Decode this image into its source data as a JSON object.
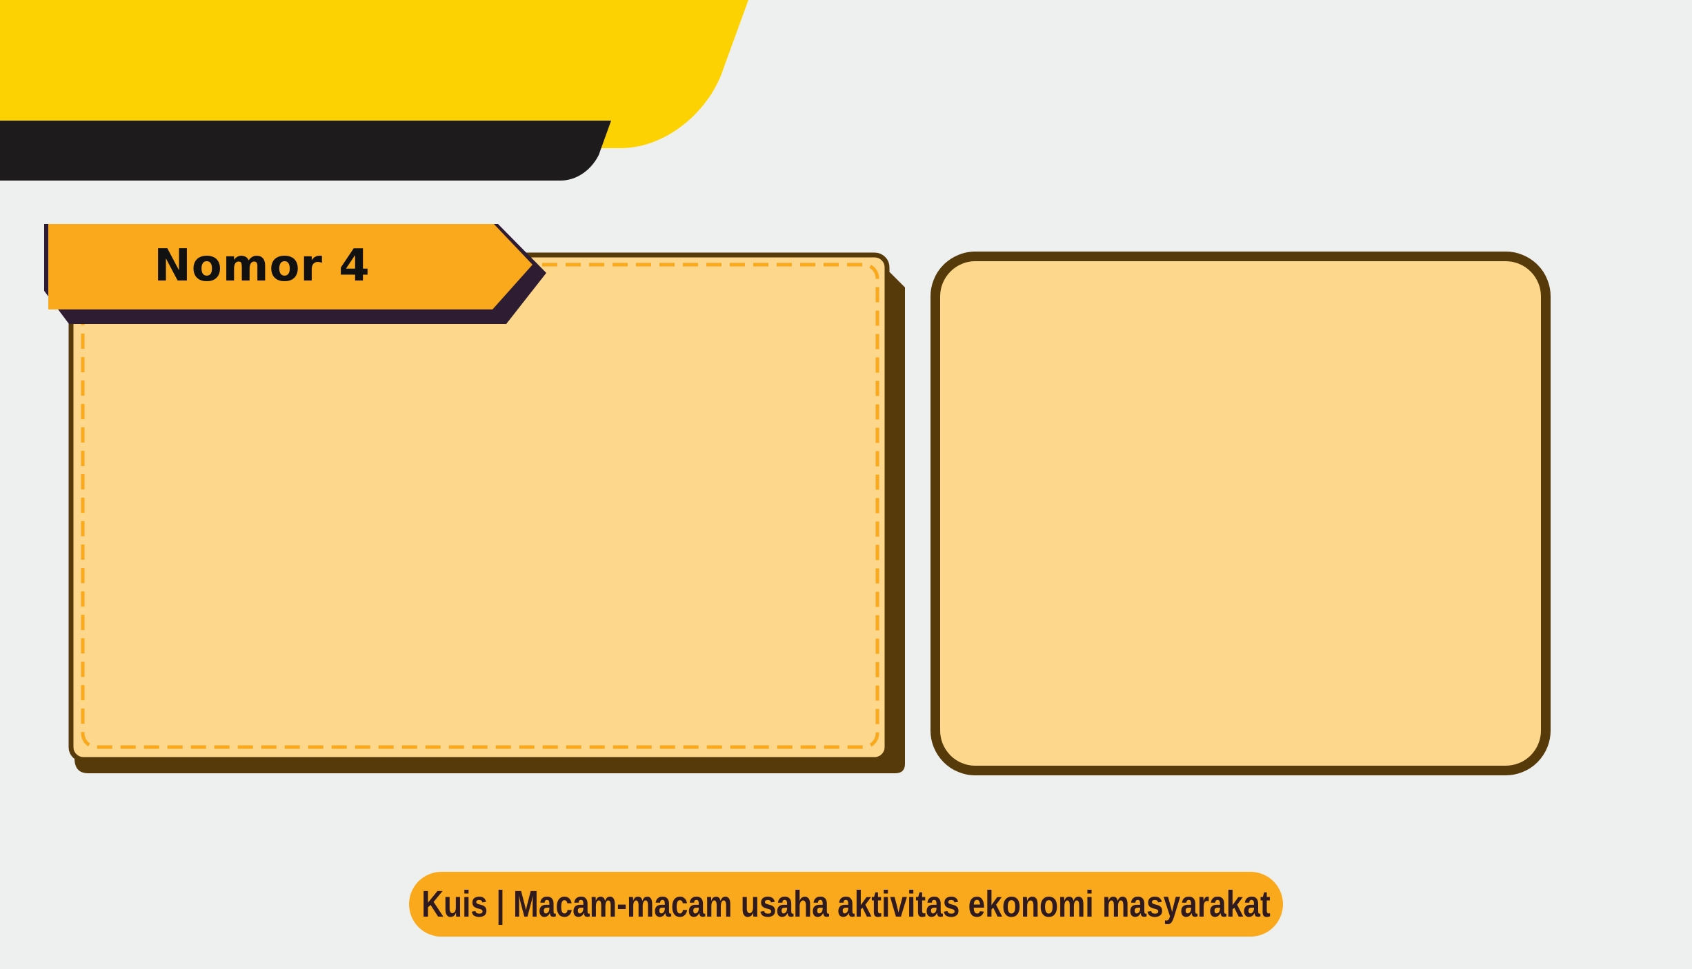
{
  "colors": {
    "background": "#EEF0EF",
    "yellow_band": "#FDD203",
    "dark_band": "#1E1B1C",
    "orange": "#F9A91B",
    "panel_fill": "#FDD78C",
    "panel_border": "#573A0A",
    "tab_shadow": "#2D1C32",
    "footer_text": "#2E1A1F"
  },
  "question": {
    "label": "Nomor 4"
  },
  "footer": {
    "title": "Kuis | Macam-macam usaha aktivitas ekonomi masyarakat"
  }
}
